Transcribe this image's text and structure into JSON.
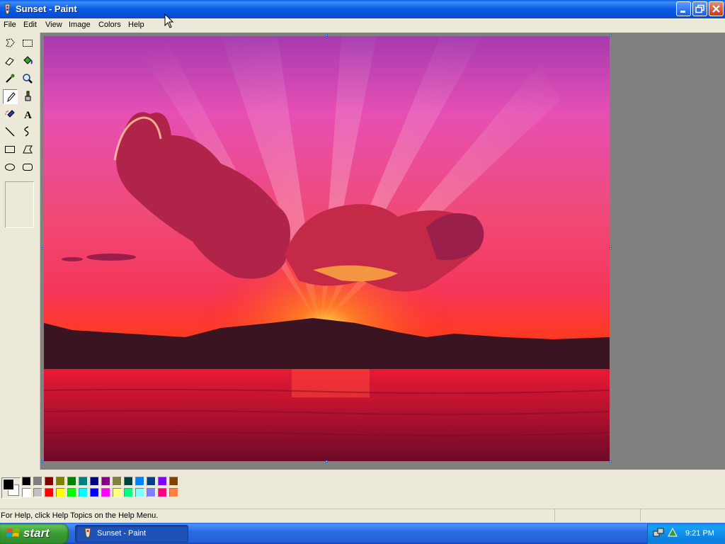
{
  "window": {
    "title": "Sunset - Paint"
  },
  "menu": [
    "File",
    "Edit",
    "View",
    "Image",
    "Colors",
    "Help"
  ],
  "tools": [
    {
      "name": "free-form-select-icon"
    },
    {
      "name": "select-icon"
    },
    {
      "name": "eraser-icon"
    },
    {
      "name": "fill-bucket-icon"
    },
    {
      "name": "color-picker-icon"
    },
    {
      "name": "magnifier-icon"
    },
    {
      "name": "pencil-icon",
      "selected": true
    },
    {
      "name": "brush-icon"
    },
    {
      "name": "airbrush-icon"
    },
    {
      "name": "text-tool-icon"
    },
    {
      "name": "line-icon"
    },
    {
      "name": "curve-icon"
    },
    {
      "name": "rectangle-icon"
    },
    {
      "name": "polygon-icon"
    },
    {
      "name": "ellipse-icon"
    },
    {
      "name": "rounded-rectangle-icon"
    }
  ],
  "text_tool_glyph": "A",
  "colors": {
    "foreground": "#000000",
    "background": "#ffffff",
    "palette_top": [
      "#000000",
      "#808080",
      "#800000",
      "#808000",
      "#008000",
      "#008080",
      "#000080",
      "#800080",
      "#808040",
      "#004040",
      "#0080ff",
      "#004080",
      "#8000ff",
      "#804000"
    ],
    "palette_bottom": [
      "#ffffff",
      "#c0c0c0",
      "#ff0000",
      "#ffff00",
      "#00ff00",
      "#00ffff",
      "#0000ff",
      "#ff00ff",
      "#ffff80",
      "#00ff80",
      "#80ffff",
      "#8080ff",
      "#ff0080",
      "#ff8040"
    ]
  },
  "status": {
    "text": "For Help, click Help Topics on the Help Menu."
  },
  "taskbar": {
    "start_label": "start",
    "task_label": "Sunset - Paint",
    "clock": "9:21 PM"
  }
}
